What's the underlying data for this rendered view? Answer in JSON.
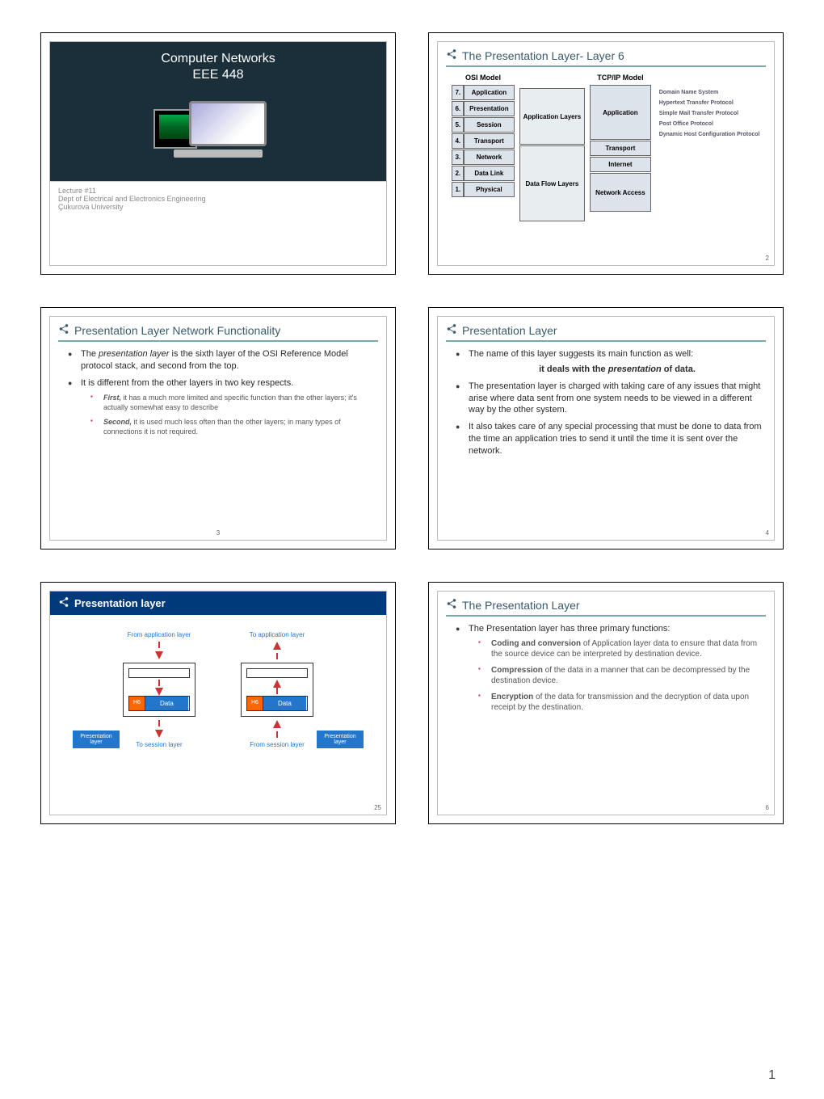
{
  "page_number": "1",
  "slide1": {
    "title": "Computer Networks",
    "subtitle": "EEE 448",
    "lecture": "Lecture #11",
    "dept": "Dept of Electrical and Electronics Engineering",
    "uni": "Çukurova University"
  },
  "slide2": {
    "title": "The Presentation Layer- Layer 6",
    "osi_header": "OSI Model",
    "tcp_header": "TCP/IP Model",
    "osi_layers": [
      {
        "n": "7.",
        "name": "Application"
      },
      {
        "n": "6.",
        "name": "Presentation"
      },
      {
        "n": "5.",
        "name": "Session"
      },
      {
        "n": "4.",
        "name": "Transport"
      },
      {
        "n": "3.",
        "name": "Network"
      },
      {
        "n": "2.",
        "name": "Data Link"
      },
      {
        "n": "1.",
        "name": "Physical"
      }
    ],
    "group_app": "Application Layers",
    "group_data": "Data Flow Layers",
    "tcp_layers": [
      "Application",
      "Transport",
      "Internet",
      "Network Access"
    ],
    "examples": [
      "Domain Name System",
      "Hypertext Transfer Protocol",
      "Simple Mail Transfer Protocol",
      "Post Office Protocol",
      "Dynamic Host Configuration Protocol"
    ],
    "num": "2"
  },
  "slide3": {
    "title": "Presentation Layer Network Functionality",
    "b1": "The presentation layer is the sixth layer of the OSI Reference Model protocol stack, and second from the top.",
    "b2": "It is different from the other layers in two key respects.",
    "s1_label": "First,",
    "s1_rest": " it has a much more limited and specific function than the other layers; it's actually somewhat easy to describe",
    "s2_label": "Second,",
    "s2_rest": " it is used much less often than the other layers; in many types of connections it is not required.",
    "num": "3"
  },
  "slide4": {
    "title": "Presentation Layer",
    "b1": "The name of this layer suggests its main function as well:",
    "b1_bold": "it deals with the presentation of data.",
    "b2": "The presentation layer is charged with taking care of any issues that might arise where data sent from one system needs to be viewed in a different way by the other system.",
    "b3": "It also takes care of any special processing that must be done to data from the time an application tries to send it until the time it is sent over the network.",
    "num": "4"
  },
  "slide5": {
    "title": "Presentation layer",
    "from_app": "From application layer",
    "to_app": "To application layer",
    "to_sess": "To session layer",
    "from_sess": "From session layer",
    "h6": "H6",
    "data": "Data",
    "player": "Presentation layer",
    "num": "25"
  },
  "slide6": {
    "title": "The Presentation Layer",
    "intro": "The Presentation layer has three primary functions:",
    "f1_label": "Coding and conversion",
    "f1_rest": " of Application layer data to ensure that data from the source device can be interpreted by destination device.",
    "f2_label": "Compression",
    "f2_rest": " of the data in a manner that can be decompressed by the destination device.",
    "f3_label": "Encryption",
    "f3_rest": " of the data for transmission and the decryption of data upon receipt by the destination.",
    "num": "6"
  }
}
